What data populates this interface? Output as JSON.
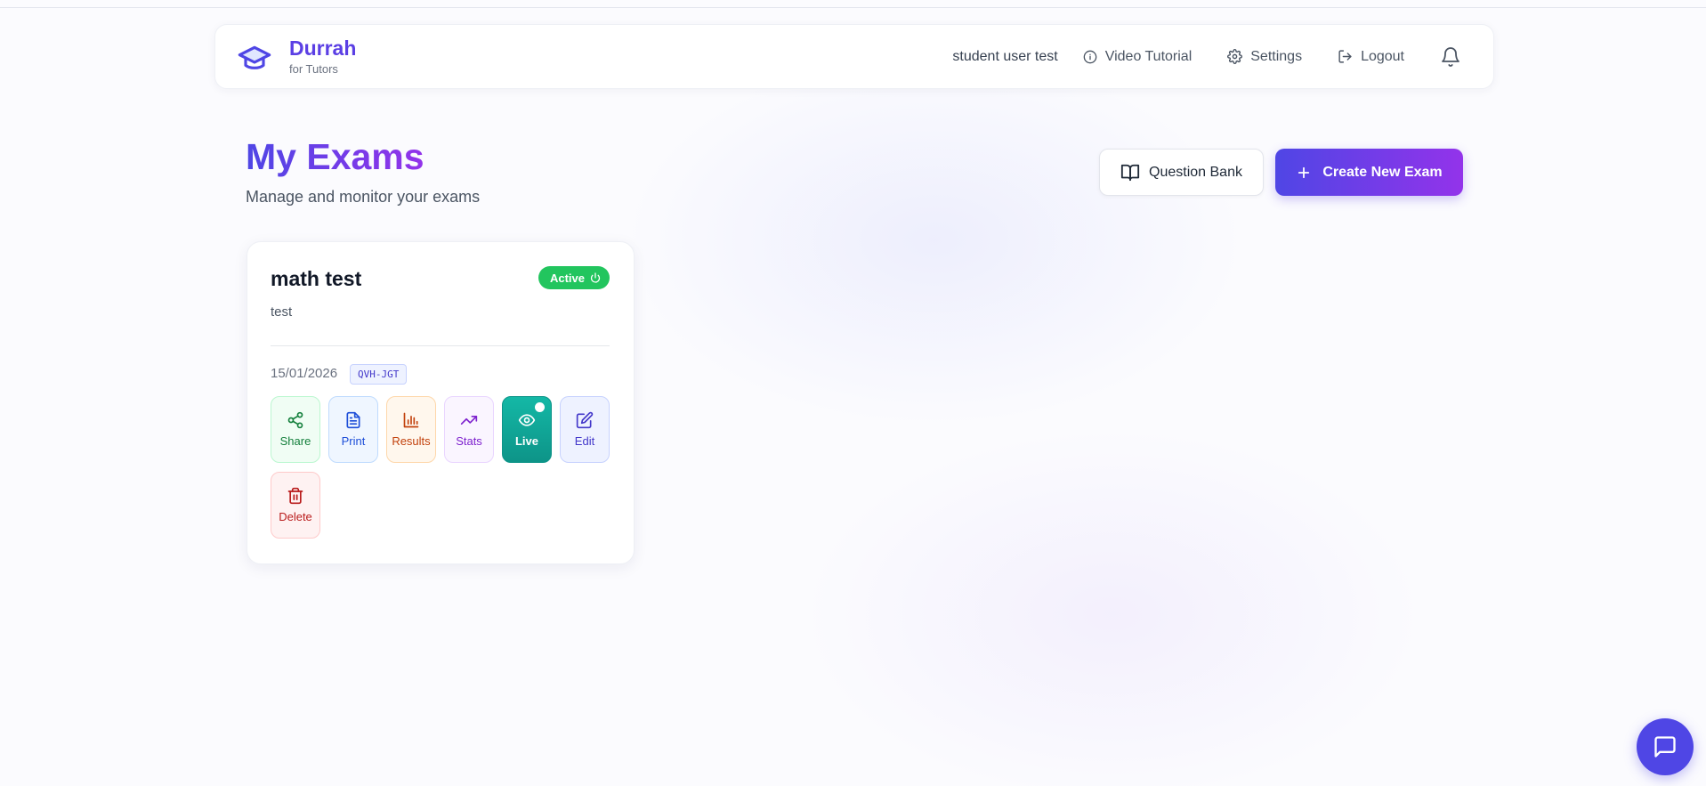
{
  "brand": {
    "name": "Durrah",
    "subtitle": "for Tutors"
  },
  "nav": {
    "user": "student user test",
    "video_tutorial": "Video Tutorial",
    "settings": "Settings",
    "logout": "Logout"
  },
  "page": {
    "title": "My Exams",
    "subtitle": "Manage and monitor your exams"
  },
  "buttons": {
    "question_bank": "Question Bank",
    "create_new_exam": "Create New Exam"
  },
  "exam": {
    "title": "math test",
    "status": "Active",
    "description": "test",
    "date": "15/01/2026",
    "code": "QVH-JGT",
    "actions": {
      "share": "Share",
      "print": "Print",
      "results": "Results",
      "stats": "Stats",
      "live": "Live",
      "edit": "Edit",
      "delete": "Delete"
    }
  },
  "colors": {
    "brand": "#5b3fe4",
    "accent_gradient_start": "#4f46e5",
    "accent_gradient_end": "#9333ea",
    "status_active": "#22c55e",
    "live": "#0d9488"
  },
  "icons": {
    "brand": "graduation-cap-icon",
    "video_tutorial": "info-icon",
    "settings": "gear-icon",
    "logout": "logout-icon",
    "notifications": "bell-icon",
    "question_bank": "open-book-icon",
    "create": "plus-icon",
    "status": "power-icon",
    "share": "share-icon",
    "print": "document-icon",
    "results": "bar-chart-icon",
    "stats": "trending-up-icon",
    "live": "eye-icon",
    "edit": "edit-icon",
    "delete": "trash-icon",
    "chat": "chat-icon"
  }
}
